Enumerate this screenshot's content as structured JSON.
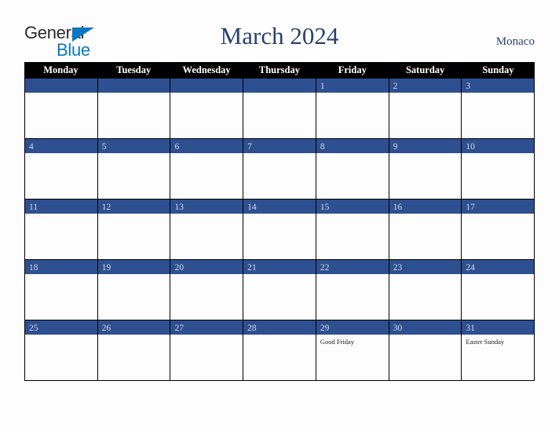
{
  "colors": {
    "background": "#fdfdfd",
    "header_bar": "#000000",
    "date_bar": "#2e5090",
    "title": "#29416e",
    "logo_blue": "#0b77c2",
    "logo_gray": "#2b2b2b",
    "date_number": "#d5dbe8",
    "grid_line": "#000000"
  },
  "logo": {
    "word_one": "General",
    "word_two": "Blue",
    "triangle_icon": "triangle-icon"
  },
  "header": {
    "title": "March 2024",
    "country": "Monaco"
  },
  "weekdays": [
    "Monday",
    "Tuesday",
    "Wednesday",
    "Thursday",
    "Friday",
    "Saturday",
    "Sunday"
  ],
  "weeks": [
    [
      {
        "date": "",
        "holiday": ""
      },
      {
        "date": "",
        "holiday": ""
      },
      {
        "date": "",
        "holiday": ""
      },
      {
        "date": "",
        "holiday": ""
      },
      {
        "date": "1",
        "holiday": ""
      },
      {
        "date": "2",
        "holiday": ""
      },
      {
        "date": "3",
        "holiday": ""
      }
    ],
    [
      {
        "date": "4",
        "holiday": ""
      },
      {
        "date": "5",
        "holiday": ""
      },
      {
        "date": "6",
        "holiday": ""
      },
      {
        "date": "7",
        "holiday": ""
      },
      {
        "date": "8",
        "holiday": ""
      },
      {
        "date": "9",
        "holiday": ""
      },
      {
        "date": "10",
        "holiday": ""
      }
    ],
    [
      {
        "date": "11",
        "holiday": ""
      },
      {
        "date": "12",
        "holiday": ""
      },
      {
        "date": "13",
        "holiday": ""
      },
      {
        "date": "14",
        "holiday": ""
      },
      {
        "date": "15",
        "holiday": ""
      },
      {
        "date": "16",
        "holiday": ""
      },
      {
        "date": "17",
        "holiday": ""
      }
    ],
    [
      {
        "date": "18",
        "holiday": ""
      },
      {
        "date": "19",
        "holiday": ""
      },
      {
        "date": "20",
        "holiday": ""
      },
      {
        "date": "21",
        "holiday": ""
      },
      {
        "date": "22",
        "holiday": ""
      },
      {
        "date": "23",
        "holiday": ""
      },
      {
        "date": "24",
        "holiday": ""
      }
    ],
    [
      {
        "date": "25",
        "holiday": ""
      },
      {
        "date": "26",
        "holiday": ""
      },
      {
        "date": "27",
        "holiday": ""
      },
      {
        "date": "28",
        "holiday": ""
      },
      {
        "date": "29",
        "holiday": "Good Friday"
      },
      {
        "date": "30",
        "holiday": ""
      },
      {
        "date": "31",
        "holiday": "Easter Sunday"
      }
    ]
  ]
}
